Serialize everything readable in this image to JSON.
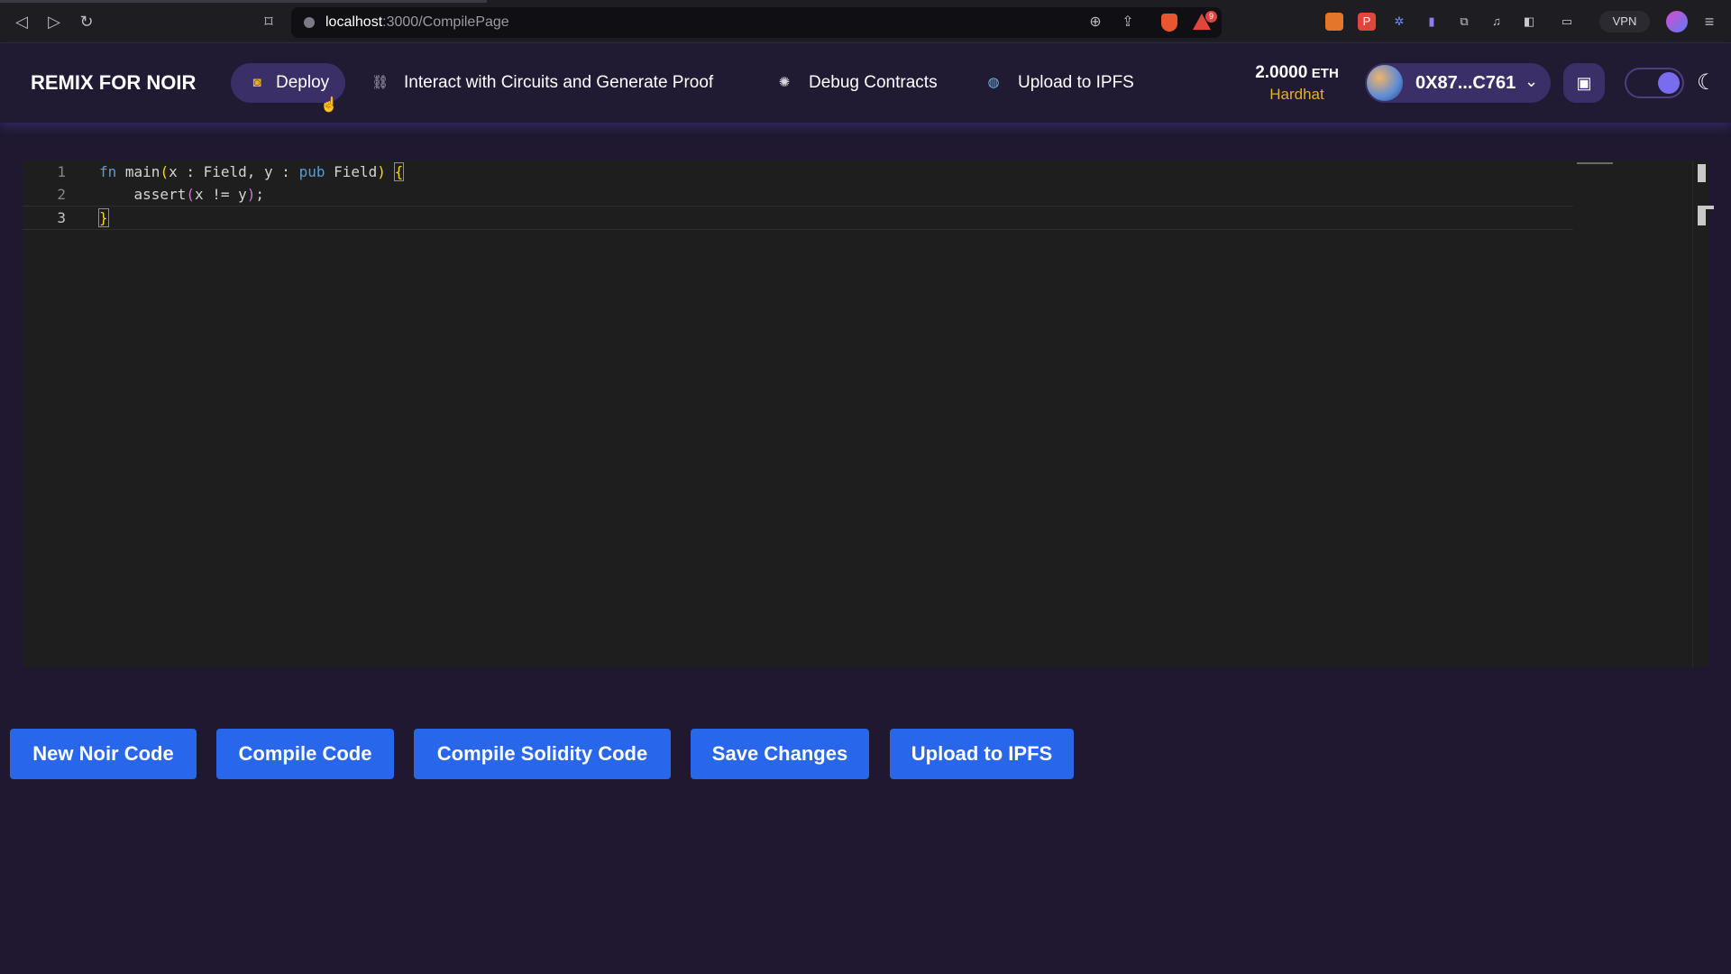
{
  "browser": {
    "url_host": "localhost",
    "url_path": ":3000/CompilePage",
    "vpn_label": "VPN",
    "alert_count": "9"
  },
  "header": {
    "brand": "REMIX FOR NOIR",
    "nav": [
      {
        "label": "Deploy",
        "icon": "wallet-icon"
      },
      {
        "label": "Interact with Circuits and Generate Proof",
        "icon": "link-icon"
      },
      {
        "label": "Debug Contracts",
        "icon": "bug-icon"
      },
      {
        "label": "Upload to IPFS",
        "icon": "globe-icon"
      }
    ],
    "balance_amount": "2.0000",
    "balance_unit": "ETH",
    "network": "Hardhat",
    "wallet_address": "0X87...C761",
    "colors": {
      "accent": "#3b2f67",
      "network": "#e4b02b",
      "background": "#1f1830"
    }
  },
  "editor": {
    "lines": [
      {
        "number": "1",
        "text": "fn main(x : Field, y : pub Field) {"
      },
      {
        "number": "2",
        "text": "    assert(x != y);"
      },
      {
        "number": "3",
        "text": "}"
      }
    ]
  },
  "actions": {
    "new_noir": "New Noir Code",
    "compile": "Compile Code",
    "compile_solidity": "Compile Solidity Code",
    "save": "Save Changes",
    "upload": "Upload to IPFS",
    "color": "#2866ea"
  }
}
